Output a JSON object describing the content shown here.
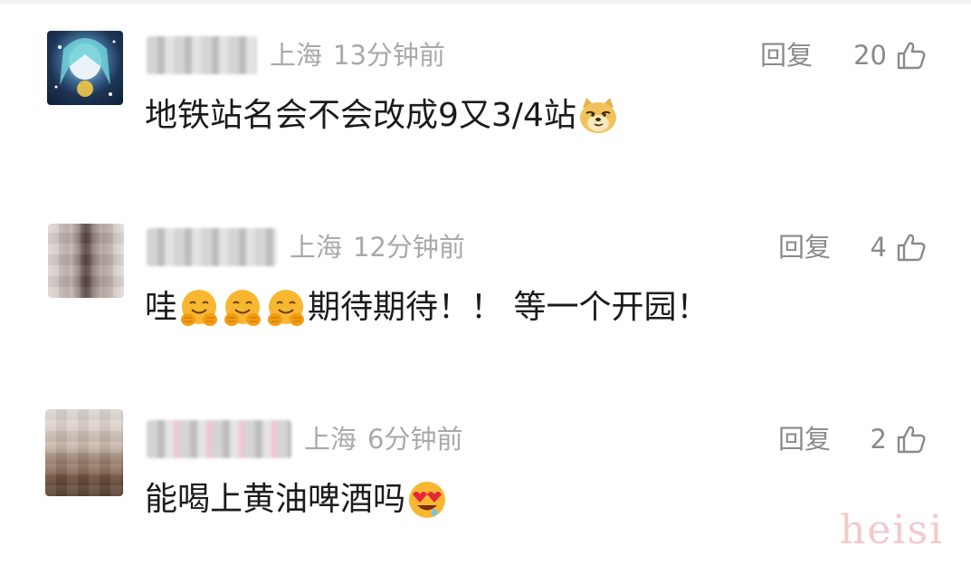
{
  "comments": [
    {
      "location": "上海",
      "time": "13分钟前",
      "reply_label": "回复",
      "likes": "20",
      "text": "地铁站名会不会改成9又3/4站",
      "emoji": "doge-emoji"
    },
    {
      "location": "上海",
      "time": "12分钟前",
      "reply_label": "回复",
      "likes": "4",
      "text_start": "哇",
      "text_end": "期待期待！！ 等一个开园！",
      "emoji": "hugging-face-emoji"
    },
    {
      "location": "上海",
      "time": "6分钟前",
      "reply_label": "回复",
      "likes": "2",
      "text": "能喝上黄油啤酒吗",
      "emoji": "heart-eyes-drool-emoji"
    }
  ],
  "watermark": "heisi",
  "colors": {
    "meta_text": "#a9a9a9",
    "action_text": "#8a8a8a",
    "body_text": "#1b1b1b",
    "watermark": "#f4c9c9"
  }
}
